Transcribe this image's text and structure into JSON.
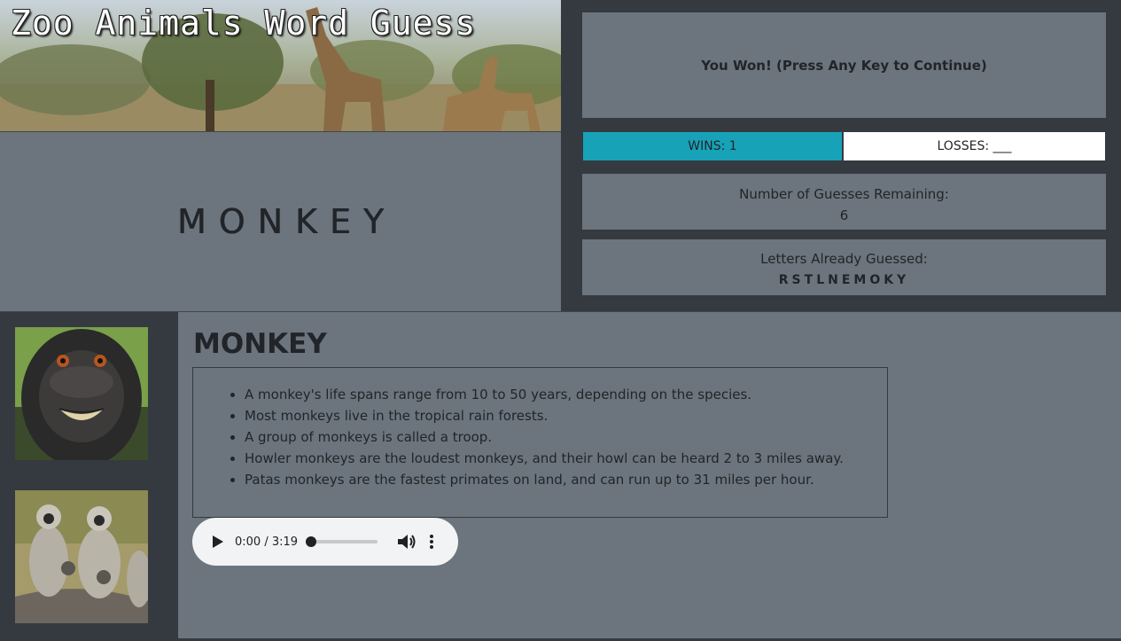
{
  "banner": {
    "title": "Zoo Animals Word Guess"
  },
  "game": {
    "word": "MONKEY",
    "status": "You Won! (Press Any Key to Continue)",
    "wins_label": "WINS: 1",
    "losses_label": "LOSSES: ___",
    "guesses_label": "Number of Guesses Remaining:",
    "guesses_value": "6",
    "letters_label": "Letters Already Guessed:",
    "letters_value": "RSTLNEMOKY"
  },
  "animal": {
    "title": "MONKEY",
    "facts": [
      "A monkey's life spans range from 10 to 50 years, depending on the species.",
      "Most monkeys live in the tropical rain forests.",
      "A group of monkeys is called a troop.",
      "Howler monkeys are the loudest monkeys, and their howl can be heard 2 to 3 miles away.",
      "Patas monkeys are the fastest primates on land, and can run up to 31 miles per hour."
    ]
  },
  "audio": {
    "time": "0:00 / 3:19",
    "progress": 0
  },
  "colors": {
    "background": "#343a40",
    "panel": "#6c757d",
    "wins": "#17a2b8",
    "losses": "#ffffff"
  },
  "icons": [
    "play-icon",
    "volume-icon",
    "more-vert-icon"
  ]
}
